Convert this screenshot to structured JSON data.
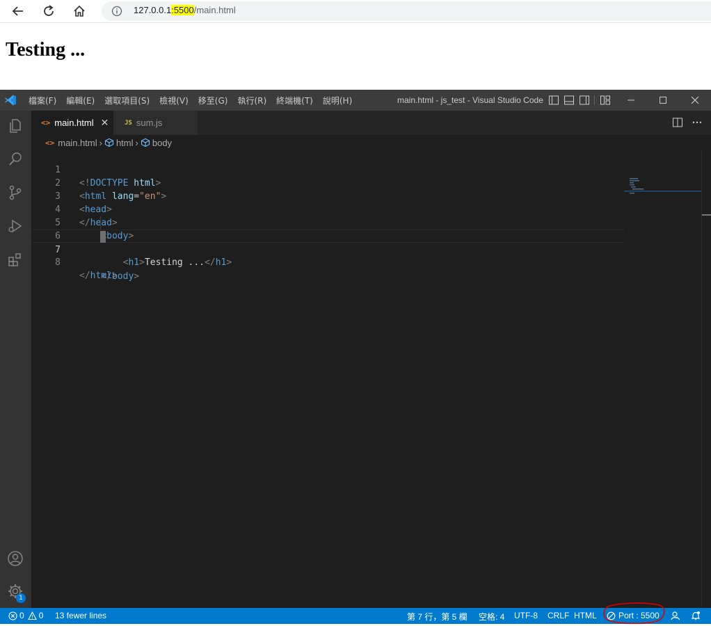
{
  "browser": {
    "url_host": "127.0.0.1",
    "url_port": ":5500",
    "url_path": "/main.html"
  },
  "page": {
    "heading": "Testing ..."
  },
  "vscode": {
    "menu": [
      "檔案(F)",
      "編輯(E)",
      "選取項目(S)",
      "檢視(V)",
      "移至(G)",
      "執行(R)",
      "終端機(T)",
      "說明(H)"
    ],
    "window_title": "main.html - js_test - Visual Studio Code",
    "tabs": [
      {
        "label": "main.html",
        "active": true
      },
      {
        "label": "sum.js",
        "active": false
      }
    ],
    "breadcrumb": [
      "main.html",
      "html",
      "body"
    ],
    "code_lines": [
      {
        "n": "1",
        "text": "<!DOCTYPE html>"
      },
      {
        "n": "2",
        "text": "<html lang=\"en\">"
      },
      {
        "n": "3",
        "text": "<head>"
      },
      {
        "n": "4",
        "text": "</head>"
      },
      {
        "n": "5",
        "text": "    <body>"
      },
      {
        "n": "6",
        "text": "        <h1>Testing ...</h1>"
      },
      {
        "n": "7",
        "text": "    </body>"
      },
      {
        "n": "8",
        "text": "</html>"
      }
    ],
    "active_line": "7",
    "accounts_badge": "1",
    "status": {
      "errors": "0",
      "warnings": "0",
      "message": "13 fewer lines",
      "position": "第 7 行，第 5 欄",
      "spaces": "空格: 4",
      "encoding": "UTF-8",
      "eol": "CRLF",
      "language": "HTML",
      "port": "Port : 5500"
    }
  },
  "colors": {
    "statusbar": "#007acc",
    "titlebar": "#3c3c3c",
    "editor_bg": "#1e1e1e",
    "highlight": "#ffff00",
    "annotation": "#e00000"
  }
}
